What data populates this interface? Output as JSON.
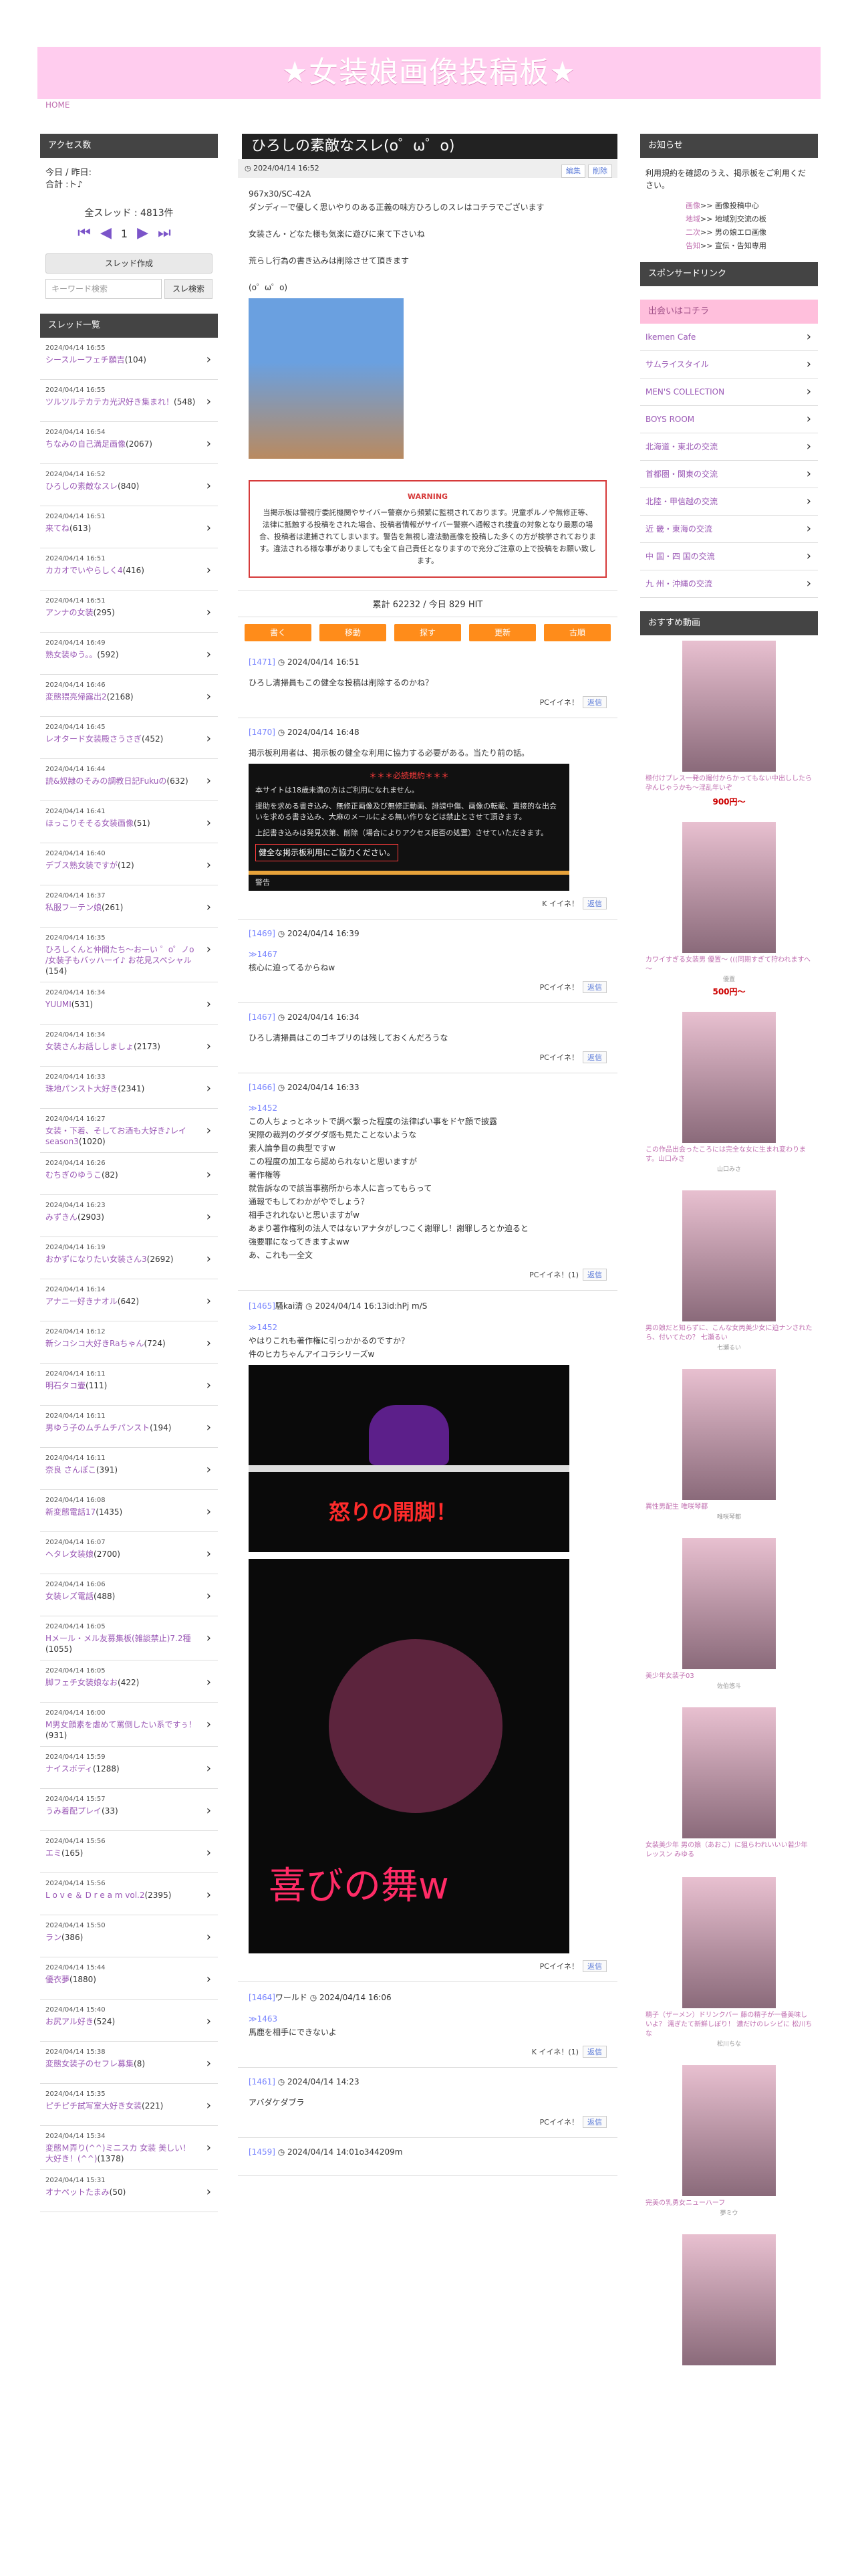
{
  "header": {
    "title": "★女装娘画像投稿板★",
    "breadcrumb": "HOME"
  },
  "left": {
    "access_title": "アクセス数",
    "today_label": "今日 / 昨日:",
    "total_label": "合計 :",
    "total_suffix": "ト♪",
    "thread_total": "全スレッド : 4813件",
    "page_num": "1",
    "create_label": "スレッド作成",
    "search_placeholder": "キーワード検索",
    "search_button": "スレ検索",
    "list_title": "スレッド一覧",
    "threads": [
      {
        "date": "2024/04/14 16:55",
        "title": "シースルーフェチ願吉",
        "count": "(104)"
      },
      {
        "date": "2024/04/14 16:55",
        "title": "ツルツルテカテカ光沢好き集まれ！",
        "count": "(548)"
      },
      {
        "date": "2024/04/14 16:54",
        "title": "ちなみの自己満足画像",
        "count": "(2067)"
      },
      {
        "date": "2024/04/14 16:52",
        "title": "ひろしの素敵なスレ",
        "count": "(840)"
      },
      {
        "date": "2024/04/14 16:51",
        "title": "来てね",
        "count": "(613)"
      },
      {
        "date": "2024/04/14 16:51",
        "title": "カカオでいやらしく4",
        "count": "(416)"
      },
      {
        "date": "2024/04/14 16:51",
        "title": "アンナの女装",
        "count": "(295)"
      },
      {
        "date": "2024/04/14 16:49",
        "title": "熟女装ゆう。。",
        "count": "(592)"
      },
      {
        "date": "2024/04/14 16:46",
        "title": "変態猥亮帰露出2",
        "count": "(2168)"
      },
      {
        "date": "2024/04/14 16:45",
        "title": "レオタード女装殿さうさぎ",
        "count": "(452)"
      },
      {
        "date": "2024/04/14 16:44",
        "title": "読&奴隷のそみの調教日記Fukuの",
        "count": "(632)"
      },
      {
        "date": "2024/04/14 16:41",
        "title": "ほっこりそそる女装画像",
        "count": "(51)"
      },
      {
        "date": "2024/04/14 16:40",
        "title": "デブス熟女装ですが",
        "count": "(12)"
      },
      {
        "date": "2024/04/14 16:37",
        "title": "私服フーテン娘",
        "count": "(261)"
      },
      {
        "date": "2024/04/14 16:35",
        "title": "ひろしくんと仲間たち〜おーい ゜ο゜ノo /女装子もバッハーイ♪ お花見スペシャル",
        "count": "(154)"
      },
      {
        "date": "2024/04/14 16:34",
        "title": "YUUMI",
        "count": "(531)"
      },
      {
        "date": "2024/04/14 16:34",
        "title": "女装さんお話ししましょ",
        "count": "(2173)"
      },
      {
        "date": "2024/04/14 16:33",
        "title": "珠地パンスト大好き",
        "count": "(2341)"
      },
      {
        "date": "2024/04/14 16:27",
        "title": "女装・下着、そしてお酒も大好き♪レイ season3",
        "count": "(1020)"
      },
      {
        "date": "2024/04/14 16:26",
        "title": "むちぎのゆうこ",
        "count": "(82)"
      },
      {
        "date": "2024/04/14 16:23",
        "title": "みずきん",
        "count": "(2903)"
      },
      {
        "date": "2024/04/14 16:19",
        "title": "おかずになりたい女装さん3",
        "count": "(2692)"
      },
      {
        "date": "2024/04/14 16:14",
        "title": "アナニー好きナオル",
        "count": "(642)"
      },
      {
        "date": "2024/04/14 16:12",
        "title": "新シコシコ大好きRaちゃん",
        "count": "(724)"
      },
      {
        "date": "2024/04/14 16:11",
        "title": "明石タコ壷",
        "count": "(111)"
      },
      {
        "date": "2024/04/14 16:11",
        "title": "男ゆう子のムチムチパンスト",
        "count": "(194)"
      },
      {
        "date": "2024/04/14 16:11",
        "title": "奈良 さんぽこ",
        "count": "(391)"
      },
      {
        "date": "2024/04/14 16:08",
        "title": "新変態電話17",
        "count": "(1435)"
      },
      {
        "date": "2024/04/14 16:07",
        "title": "ヘタレ女装娘",
        "count": "(2700)"
      },
      {
        "date": "2024/04/14 16:06",
        "title": "女装レズ電話",
        "count": "(488)"
      },
      {
        "date": "2024/04/14 16:05",
        "title": "Hメール・メル友募集板(雑談禁止)7.2種",
        "count": "(1055)"
      },
      {
        "date": "2024/04/14 16:05",
        "title": "脚フェチ女装娘なお",
        "count": "(422)"
      },
      {
        "date": "2024/04/14 16:00",
        "title": "M男女顔素を虐めて罵倒したい系ですぅ！",
        "count": "(931)"
      },
      {
        "date": "2024/04/14 15:59",
        "title": "ナイスボディ",
        "count": "(1288)"
      },
      {
        "date": "2024/04/14 15:57",
        "title": "うみ着配プレイ",
        "count": "(33)"
      },
      {
        "date": "2024/04/14 15:56",
        "title": "エミ",
        "count": "(165)"
      },
      {
        "date": "2024/04/14 15:56",
        "title": "L o v e ＆ D r e a m vol.2",
        "count": "(2395)"
      },
      {
        "date": "2024/04/14 15:50",
        "title": "ラン",
        "count": "(386)"
      },
      {
        "date": "2024/04/14 15:44",
        "title": "優衣夢",
        "count": "(1880)"
      },
      {
        "date": "2024/04/14 15:40",
        "title": "お尻アル好き",
        "count": "(524)"
      },
      {
        "date": "2024/04/14 15:38",
        "title": "変態女装子のセフレ募集",
        "count": "(8)"
      },
      {
        "date": "2024/04/14 15:35",
        "title": "ピチピチ試写室大好き女装",
        "count": "(221)"
      },
      {
        "date": "2024/04/14 15:34",
        "title": "変態Ｍ弄り(^^)ミニスカ 女装 美しい！ 大好き！(^^)",
        "count": "(1378)"
      },
      {
        "date": "2024/04/14 15:31",
        "title": "オナペットたまみ",
        "count": "(50)"
      }
    ]
  },
  "center": {
    "topic_title": "ひろしの素敵なスレ(o゜ω゜o)",
    "topic_date": "2024/04/14 16:52",
    "edit_label": "編集",
    "delete_label": "削除",
    "body_id": "967x30/SC-42A",
    "body1": "ダンディーで優しく思いやりのある正義の味方ひろしのスレはコチラでございます",
    "body2": "女装さん・どなた様も気楽に遊びに来て下さいね",
    "body3": "荒らし行為の書き込みは削除させて頂きます",
    "body4": "(o゜ω゜o)",
    "warn_title": "WARNING",
    "warn_text": "当掲示板は警視庁委託機関やサイバー警察から頻繁に監視されております。児童ポルノや無修正等、法律に抵触する投稿をされた場合、投稿者情報がサイバー警察へ通報され捜査の対象となり最悪の場合、投稿者は逮捕されてしまいます。警告を無視し違法動画像を投稿した多くの方が検挙されております。違法される様な事がありましても全て自己責任となりますので充分ご注意の上で投稿をお願い致します。",
    "counts": "累計 62232 / 今日 829 HIT",
    "actions": [
      "書く",
      "移動",
      "探す",
      "更新",
      "古順"
    ],
    "posts": [
      {
        "no": "[1471]",
        "author": "",
        "date": "2024/04/14 16:51",
        "body": "ひろし清掃員もこの健全な投稿は削除するのかね？",
        "footer": "PCイイネ！",
        "reply": "返信"
      },
      {
        "no": "[1470]",
        "author": "",
        "date": "2024/04/14 16:48",
        "body": "掲示板利用者は、掲示板の健全な利用に協力する必要がある。当たり前の話。",
        "footer": "K イイネ！",
        "reply": "返信"
      },
      {
        "no": "[1469]",
        "author": "",
        "date": "2024/04/14 16:39",
        "anchor": "≫1467",
        "body": "核心に迫ってるからねw",
        "footer": "PCイイネ！",
        "reply": "返信"
      },
      {
        "no": "[1467]",
        "author": "",
        "date": "2024/04/14 16:34",
        "body": "ひろし清掃員はこのゴキブリのは残しておくんだろうな",
        "footer": "PCイイネ！",
        "reply": "返信"
      },
      {
        "no": "[1466]",
        "author": "",
        "date": "2024/04/14 16:33",
        "anchor": "≫1452",
        "body": "この人ちょっとネットで調べ繋った程度の法律ぱい事をドヤ顔で披露",
        "footer": "PCイイネ！(1)",
        "reply": "返信"
      },
      {
        "no": "[1465]",
        "author": "騒kai清",
        "date": "2024/04/14 16:13",
        "id": "id:hPj m/S",
        "anchor": "≫1452",
        "body": "やはりこれも著作権に引っかかるのですか？",
        "footer": "PCイイネ！",
        "reply": "返信"
      },
      {
        "no": "[1464]",
        "author": "ワールド",
        "date": "2024/04/14 16:06",
        "anchor": "≫1463",
        "body": "馬鹿を相手にできないよ",
        "footer": "K イイネ！(1)",
        "reply": "返信"
      },
      {
        "no": "[1461]",
        "author": "",
        "date": "2024/04/14 14:23",
        "body": "アバダケダブラ",
        "footer": "PCイイネ！",
        "reply": "返信"
      },
      {
        "no": "[1459]",
        "author": "",
        "date": "2024/04/14 14:01",
        "id": "o344209m",
        "body": ""
      }
    ],
    "post1470": {
      "warn_red": "＊＊＊必読規約＊＊＊",
      "lines": [
        "本サイトは18歳未満の方はご利用になれません。",
        "援助を求める書き込み、無修正画像及び無修正動画、誹謗中傷、画像の転載、直接的な出会いを求める書き込み、大麻のメールによる無い作りなどは禁止とさせて頂きます。",
        "上記書き込みは発見次第、削除（場合によりアクセス拒否の処置）させていただきます。"
      ],
      "ok": "健全な掲示板利用にご協力ください。",
      "foot": "警告"
    },
    "post1466_extra": [
      "実際の裁判のグダグダ感も見たことないような",
      "素人論争目の典型ですw",
      "この程度の加工なら認められないと思いますが",
      "著作権等",
      "就告訴なので該当事務所から本人に言ってもらって",
      "通報でもしてわかがやでしょう？",
      "相手されれないと思いますがw",
      "あまり著作権利の法人ではないアナタがしつこく謝罪し！謝罪しろとか迫ると",
      "強要罪になってきますよww",
      "あ、これも一全文"
    ],
    "post1465_extra": "件のヒカちゃんアイコラシリーズw",
    "img_cap1": "怒りの開脚！",
    "img_cap2": "喜びの舞w"
  },
  "right": {
    "notice_title": "お知らせ",
    "notice_text": "利用規約を確認のうえ、掲示板をご利用ください。",
    "notice_link": "利用規約",
    "boards": [
      {
        "k": "画像",
        "v": ">> 画像投稿中心"
      },
      {
        "k": "地域",
        "v": ">> 地域別交流の板"
      },
      {
        "k": "二次",
        "v": ">> 男の娘エロ画像"
      },
      {
        "k": "告知",
        "v": ">> 宣伝・告知専用"
      }
    ],
    "sponsor_title": "スポンサードリンク",
    "meet_title": "出会いはコチラ",
    "meet_links": [
      "Ikemen Cafe",
      "サムライスタイル",
      "MEN'S COLLECTION",
      "BOYS ROOM",
      "北海道・東北の交流",
      "首都圏・関東の交流",
      "北陸・甲信越の交流",
      "近 畿・東海の交流",
      "中 国・四 国の交流",
      "九 州・沖縄の交流"
    ],
    "video_title": "おすすめ動画",
    "videos": [
      {
        "cap": "極付けプレス一発の撮付からかってもない中出ししたら孕んじゃうかも～淫乱年いぞ",
        "price": "900円～",
        "sub": ""
      },
      {
        "cap": "カワイすぎる女装男 優置～ (((同期すぎて狩われますへ～",
        "price": "500円～",
        "sub": "優置"
      },
      {
        "cap": "この作品出会ったころには完全な女に生まれ変わります。山口みさ",
        "price": "",
        "sub": "山口みさ"
      },
      {
        "cap": "男の娘だと知らずに、こんな女丙美少女に迫ナンされたら、付いてたの？ 七瀬るい",
        "price": "",
        "sub": "七瀬るい"
      },
      {
        "cap": "異性男配生 唯咲琴都",
        "price": "",
        "sub": "唯咲琴都"
      },
      {
        "cap": "美少年女装子03",
        "price": "",
        "sub": "佐伯悠斗"
      },
      {
        "cap": "女装美少年 男の娘（あおこ）に狙らわれいいい若少年レッスン みゆる",
        "price": "",
        "sub": ""
      },
      {
        "cap": "精子（ザーメン）ドリンクバー 藤の精子が一番美味しいよ？ 濡ぎたて新鮮しぼり！ 濃だけのレシピに 松川ちな",
        "price": "",
        "sub": "松川ちな"
      },
      {
        "cap": "完美の乳勇女ニューハーフ",
        "price": "",
        "sub": "夢ミウ"
      },
      {
        "cap": "",
        "price": "",
        "sub": ""
      }
    ]
  }
}
